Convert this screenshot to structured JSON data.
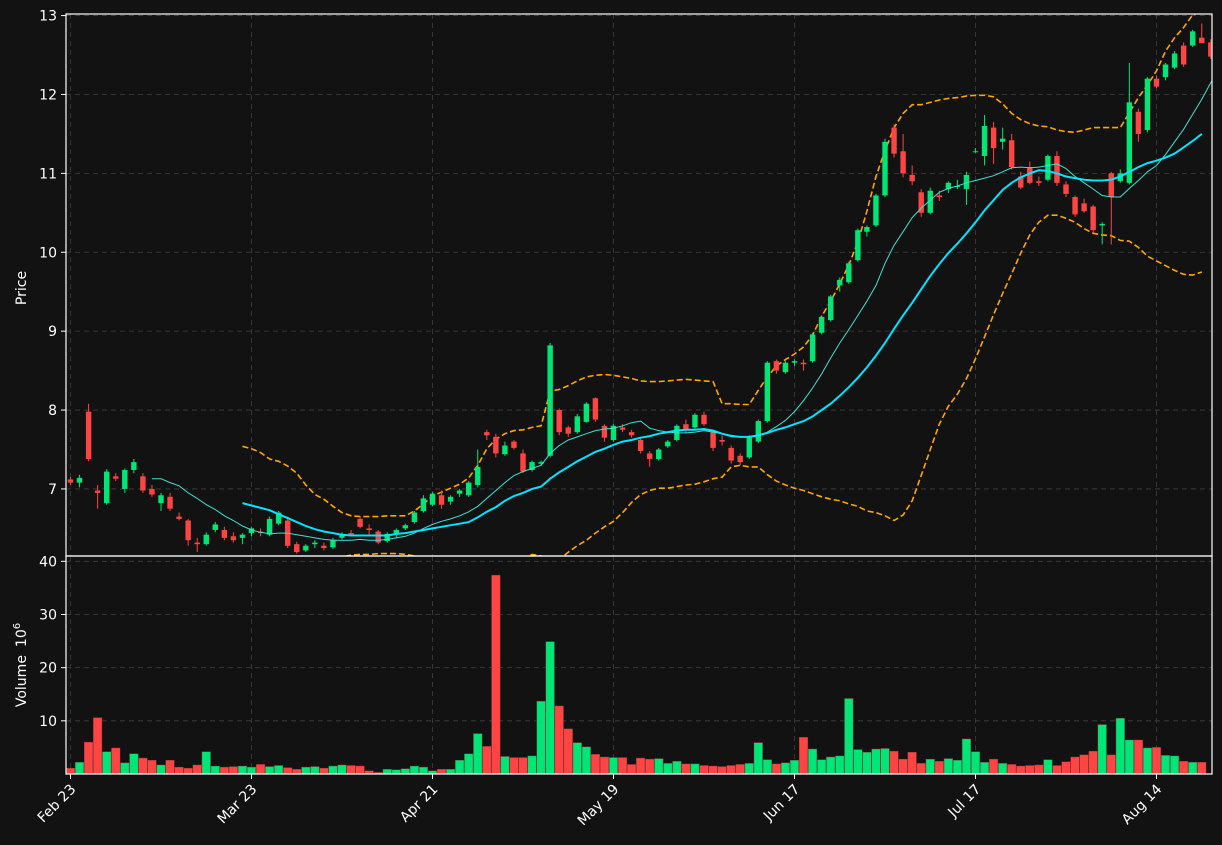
{
  "chart_data": {
    "type": "candlestick",
    "background": "#121212",
    "colors": {
      "up": "#00e676",
      "down": "#ff4444",
      "ma_fast": "#40e0d0",
      "ma_slow": "#00e5ff",
      "bollinger": "#ffa500",
      "grid": "#404040",
      "axis": "#ffffff"
    },
    "price_axis": {
      "label": "Price",
      "ylim": [
        6.15,
        13.02
      ],
      "ticks": [
        7,
        8,
        9,
        10,
        11,
        12,
        13
      ]
    },
    "volume_axis": {
      "label": "Volume",
      "unit_exponent": "6",
      "ylim": [
        0,
        41
      ],
      "ticks": [
        10,
        20,
        30,
        40
      ]
    },
    "x_tick_labels": [
      "Feb 23",
      "Mar 23",
      "Apr 21",
      "May 19",
      "Jun 17",
      "Jul 17",
      "Aug 14"
    ],
    "x_tick_index": [
      0,
      20,
      40,
      60,
      80,
      100,
      120
    ],
    "grid": true,
    "ohlc": [
      [
        7.12,
        7.15,
        7.05,
        7.08
      ],
      [
        7.08,
        7.18,
        7.02,
        7.14
      ],
      [
        7.98,
        8.08,
        7.35,
        7.38
      ],
      [
        6.98,
        7.05,
        6.75,
        6.95
      ],
      [
        6.82,
        7.25,
        6.8,
        7.22
      ],
      [
        7.16,
        7.2,
        7.1,
        7.13
      ],
      [
        7.0,
        7.26,
        6.95,
        7.24
      ],
      [
        7.24,
        7.38,
        7.2,
        7.34
      ],
      [
        7.16,
        7.2,
        6.95,
        6.98
      ],
      [
        7.0,
        7.05,
        6.9,
        6.93
      ],
      [
        6.82,
        6.95,
        6.72,
        6.92
      ],
      [
        6.9,
        6.95,
        6.72,
        6.75
      ],
      [
        6.65,
        6.7,
        6.6,
        6.62
      ],
      [
        6.6,
        6.62,
        6.28,
        6.35
      ],
      [
        6.32,
        6.38,
        6.2,
        6.3
      ],
      [
        6.3,
        6.45,
        6.28,
        6.42
      ],
      [
        6.48,
        6.58,
        6.45,
        6.55
      ],
      [
        6.48,
        6.52,
        6.35,
        6.38
      ],
      [
        6.4,
        6.45,
        6.32,
        6.35
      ],
      [
        6.38,
        6.44,
        6.3,
        6.42
      ],
      [
        6.44,
        6.52,
        6.4,
        6.5
      ],
      [
        6.46,
        6.5,
        6.4,
        6.44
      ],
      [
        6.42,
        6.65,
        6.4,
        6.62
      ],
      [
        6.56,
        6.72,
        6.54,
        6.7
      ],
      [
        6.6,
        6.65,
        6.25,
        6.28
      ],
      [
        6.3,
        6.33,
        6.18,
        6.2
      ],
      [
        6.22,
        6.3,
        6.2,
        6.28
      ],
      [
        6.3,
        6.35,
        6.25,
        6.32
      ],
      [
        6.28,
        6.32,
        6.22,
        6.25
      ],
      [
        6.26,
        6.38,
        6.24,
        6.35
      ],
      [
        6.38,
        6.45,
        6.36,
        6.42
      ],
      [
        6.44,
        6.48,
        6.4,
        6.42
      ],
      [
        6.62,
        6.65,
        6.5,
        6.52
      ],
      [
        6.5,
        6.55,
        6.42,
        6.48
      ],
      [
        6.46,
        6.48,
        6.3,
        6.32
      ],
      [
        6.34,
        6.45,
        6.32,
        6.43
      ],
      [
        6.44,
        6.5,
        6.38,
        6.48
      ],
      [
        6.5,
        6.56,
        6.48,
        6.54
      ],
      [
        6.58,
        6.72,
        6.56,
        6.7
      ],
      [
        6.72,
        6.92,
        6.7,
        6.88
      ],
      [
        6.8,
        6.96,
        6.78,
        6.94
      ],
      [
        6.92,
        6.98,
        6.75,
        6.8
      ],
      [
        6.84,
        6.92,
        6.8,
        6.9
      ],
      [
        6.94,
        7.0,
        6.9,
        6.98
      ],
      [
        6.92,
        7.1,
        6.9,
        7.08
      ],
      [
        7.05,
        7.5,
        7.02,
        7.28
      ],
      [
        7.72,
        7.75,
        7.62,
        7.68
      ],
      [
        7.66,
        7.7,
        7.4,
        7.45
      ],
      [
        7.44,
        7.6,
        7.42,
        7.55
      ],
      [
        7.6,
        7.62,
        7.5,
        7.52
      ],
      [
        7.45,
        7.5,
        7.2,
        7.22
      ],
      [
        7.24,
        7.36,
        7.22,
        7.34
      ],
      [
        7.32,
        7.36,
        7.3,
        7.34
      ],
      [
        7.42,
        8.85,
        7.4,
        8.82
      ],
      [
        8.0,
        8.02,
        7.68,
        7.72
      ],
      [
        7.78,
        7.8,
        7.66,
        7.7
      ],
      [
        7.72,
        7.95,
        7.7,
        7.92
      ],
      [
        7.85,
        8.1,
        7.84,
        8.08
      ],
      [
        8.15,
        8.16,
        7.85,
        7.88
      ],
      [
        7.8,
        7.82,
        7.6,
        7.65
      ],
      [
        7.62,
        7.82,
        7.6,
        7.8
      ],
      [
        7.78,
        7.82,
        7.72,
        7.75
      ],
      [
        7.72,
        7.75,
        7.65,
        7.68
      ],
      [
        7.62,
        7.65,
        7.45,
        7.48
      ],
      [
        7.45,
        7.48,
        7.28,
        7.38
      ],
      [
        7.38,
        7.52,
        7.36,
        7.5
      ],
      [
        7.54,
        7.62,
        7.52,
        7.6
      ],
      [
        7.62,
        7.82,
        7.6,
        7.8
      ],
      [
        7.82,
        7.88,
        7.7,
        7.74
      ],
      [
        7.78,
        7.96,
        7.76,
        7.94
      ],
      [
        7.94,
        7.98,
        7.8,
        7.82
      ],
      [
        7.72,
        7.75,
        7.48,
        7.52
      ],
      [
        7.62,
        7.68,
        7.55,
        7.6
      ],
      [
        7.52,
        7.55,
        7.32,
        7.36
      ],
      [
        7.42,
        7.45,
        7.3,
        7.34
      ],
      [
        7.4,
        7.68,
        7.38,
        7.66
      ],
      [
        7.6,
        7.88,
        7.58,
        7.86
      ],
      [
        7.86,
        8.62,
        7.84,
        8.6
      ],
      [
        8.62,
        8.64,
        8.46,
        8.5
      ],
      [
        8.48,
        8.62,
        8.46,
        8.6
      ],
      [
        8.6,
        8.64,
        8.56,
        8.62
      ],
      [
        8.6,
        8.64,
        8.5,
        8.58
      ],
      [
        8.62,
        8.98,
        8.6,
        8.96
      ],
      [
        8.98,
        9.2,
        8.96,
        9.18
      ],
      [
        9.14,
        9.46,
        9.12,
        9.44
      ],
      [
        9.58,
        9.68,
        9.5,
        9.65
      ],
      [
        9.62,
        9.88,
        9.6,
        9.86
      ],
      [
        9.9,
        10.3,
        9.88,
        10.28
      ],
      [
        10.26,
        10.34,
        10.2,
        10.32
      ],
      [
        10.34,
        10.74,
        10.32,
        10.72
      ],
      [
        10.72,
        11.44,
        10.7,
        11.4
      ],
      [
        11.58,
        11.62,
        11.2,
        11.25
      ],
      [
        11.28,
        11.5,
        10.95,
        11.0
      ],
      [
        10.98,
        11.1,
        10.85,
        10.9
      ],
      [
        10.76,
        10.8,
        10.45,
        10.5
      ],
      [
        10.5,
        10.82,
        10.48,
        10.78
      ],
      [
        10.72,
        10.78,
        10.65,
        10.7
      ],
      [
        10.8,
        10.9,
        10.75,
        10.88
      ],
      [
        10.84,
        10.92,
        10.8,
        10.84
      ],
      [
        10.8,
        11.02,
        10.6,
        10.98
      ],
      [
        11.28,
        11.32,
        11.26,
        11.28
      ],
      [
        11.22,
        11.74,
        11.1,
        11.6
      ],
      [
        11.58,
        11.65,
        11.12,
        11.32
      ],
      [
        11.4,
        11.58,
        11.3,
        11.44
      ],
      [
        11.42,
        11.5,
        11.05,
        11.08
      ],
      [
        10.96,
        11.02,
        10.8,
        10.82
      ],
      [
        11.08,
        11.15,
        10.86,
        10.88
      ],
      [
        10.9,
        10.96,
        10.84,
        10.88
      ],
      [
        10.92,
        11.24,
        10.9,
        11.22
      ],
      [
        11.22,
        11.28,
        10.84,
        10.88
      ],
      [
        10.86,
        10.9,
        10.7,
        10.74
      ],
      [
        10.7,
        10.72,
        10.45,
        10.48
      ],
      [
        10.62,
        10.68,
        10.5,
        10.52
      ],
      [
        10.58,
        10.6,
        10.25,
        10.28
      ],
      [
        10.34,
        10.38,
        10.1,
        10.36
      ],
      [
        11.0,
        11.02,
        10.1,
        10.7
      ],
      [
        10.9,
        11.05,
        10.88,
        11.0
      ],
      [
        10.88,
        12.4,
        10.86,
        11.9
      ],
      [
        11.78,
        11.82,
        11.4,
        11.5
      ],
      [
        11.55,
        12.22,
        11.52,
        12.2
      ],
      [
        12.2,
        12.24,
        12.08,
        12.1
      ],
      [
        12.22,
        12.4,
        12.18,
        12.38
      ],
      [
        12.34,
        12.55,
        12.32,
        12.52
      ],
      [
        12.62,
        12.66,
        12.35,
        12.38
      ],
      [
        12.62,
        12.82,
        12.6,
        12.8
      ],
      [
        12.72,
        12.9,
        12.7,
        12.65
      ],
      [
        12.66,
        12.7,
        12.45,
        12.48
      ]
    ],
    "volume": [
      1.1,
      2.2,
      6.0,
      10.6,
      4.2,
      4.9,
      2.1,
      3.8,
      3.0,
      2.6,
      1.7,
      2.6,
      1.3,
      1.1,
      1.7,
      4.2,
      1.5,
      1.3,
      1.4,
      1.5,
      1.3,
      1.8,
      1.4,
      1.6,
      1.2,
      0.9,
      1.3,
      1.4,
      1.1,
      1.5,
      1.7,
      1.6,
      1.5,
      0.6,
      0.3,
      0.9,
      0.8,
      1.0,
      1.5,
      1.3,
      0.6,
      0.9,
      0.9,
      2.6,
      3.8,
      7.6,
      5.2,
      37.4,
      3.3,
      3.1,
      3.1,
      3.4,
      13.7,
      24.9,
      12.8,
      8.5,
      5.9,
      5.1,
      3.7,
      3.2,
      3.1,
      3.1,
      1.8,
      3.0,
      2.8,
      2.9,
      2.0,
      2.4,
      1.9,
      1.9,
      1.6,
      1.5,
      1.4,
      1.6,
      1.8,
      2.0,
      5.9,
      2.7,
      1.9,
      2.1,
      2.6,
      6.9,
      4.7,
      2.7,
      3.2,
      3.4,
      14.2,
      4.6,
      4.1,
      4.7,
      4.8,
      4.3,
      2.8,
      4.1,
      2.0,
      2.8,
      2.4,
      2.9,
      2.6,
      6.6,
      4.2,
      2.2,
      2.8,
      2.0,
      1.8,
      1.5,
      1.6,
      1.7,
      2.7,
      1.6,
      2.3,
      3.2,
      3.6,
      4.3,
      9.3,
      3.6,
      10.5,
      6.4,
      6.4,
      4.9,
      5.0,
      3.5,
      3.4,
      2.4,
      2.2,
      2.2
    ],
    "ma_fast": [
      null,
      null,
      null,
      null,
      null,
      null,
      null,
      null,
      null,
      7.13,
      7.13,
      7.08,
      7.04,
      6.95,
      6.88,
      6.8,
      6.74,
      6.66,
      6.6,
      6.53,
      6.48,
      6.45,
      6.43,
      6.44,
      6.44,
      6.42,
      6.4,
      6.38,
      6.36,
      6.35,
      6.35,
      6.35,
      6.36,
      6.35,
      6.35,
      6.36,
      6.38,
      6.4,
      6.44,
      6.5,
      6.55,
      6.59,
      6.62,
      6.66,
      6.71,
      6.78,
      6.88,
      6.98,
      7.08,
      7.17,
      7.22,
      7.26,
      7.3,
      7.45,
      7.55,
      7.62,
      7.66,
      7.7,
      7.74,
      7.76,
      7.77,
      7.8,
      7.84,
      7.86,
      7.77,
      7.74,
      7.72,
      7.71,
      7.71,
      7.72,
      7.74,
      7.72,
      7.7,
      7.68,
      7.66,
      7.66,
      7.67,
      7.72,
      7.79,
      7.87,
      7.98,
      8.12,
      8.28,
      8.46,
      8.66,
      8.85,
      9.02,
      9.2,
      9.38,
      9.58,
      9.86,
      10.09,
      10.26,
      10.44,
      10.56,
      10.66,
      10.76,
      10.81,
      10.84,
      10.88,
      10.91,
      10.94,
      10.97,
      11.02,
      11.07,
      11.08,
      11.07,
      11.08,
      11.1,
      11.12,
      11.06,
      10.96,
      10.88,
      10.8,
      10.72,
      10.7,
      10.7,
      10.81,
      10.91,
      11.02,
      11.1,
      11.24,
      11.4,
      11.56,
      11.75,
      11.94,
      12.15,
      12.32
    ],
    "ma_slow": [
      null,
      null,
      null,
      null,
      null,
      null,
      null,
      null,
      null,
      null,
      null,
      null,
      null,
      null,
      null,
      null,
      null,
      null,
      null,
      6.82,
      6.79,
      6.76,
      6.73,
      6.68,
      6.63,
      6.58,
      6.53,
      6.49,
      6.46,
      6.44,
      6.42,
      6.41,
      6.41,
      6.41,
      6.41,
      6.41,
      6.43,
      6.44,
      6.46,
      6.48,
      6.5,
      6.52,
      6.54,
      6.56,
      6.58,
      6.64,
      6.71,
      6.77,
      6.85,
      6.91,
      6.95,
      7.0,
      7.03,
      7.13,
      7.21,
      7.28,
      7.35,
      7.41,
      7.47,
      7.51,
      7.56,
      7.6,
      7.62,
      7.65,
      7.67,
      7.7,
      7.72,
      7.74,
      7.75,
      7.75,
      7.76,
      7.74,
      7.7,
      7.67,
      7.66,
      7.66,
      7.68,
      7.71,
      7.75,
      7.78,
      7.82,
      7.86,
      7.92,
      8.0,
      8.08,
      8.18,
      8.29,
      8.41,
      8.54,
      8.69,
      8.85,
      9.03,
      9.2,
      9.36,
      9.53,
      9.7,
      9.85,
      9.99,
      10.11,
      10.24,
      10.38,
      10.53,
      10.66,
      10.79,
      10.88,
      10.95,
      11.0,
      11.04,
      11.03,
      11.0,
      10.96,
      10.94,
      10.92,
      10.91,
      10.91,
      10.92,
      10.96,
      11.02,
      11.08,
      11.13,
      11.16,
      11.2,
      11.25,
      11.33,
      11.41,
      11.5
    ],
    "boll_upper": [
      null,
      null,
      null,
      null,
      null,
      null,
      null,
      null,
      null,
      null,
      null,
      null,
      null,
      null,
      null,
      null,
      null,
      null,
      null,
      7.54,
      7.51,
      7.46,
      7.38,
      7.35,
      7.29,
      7.2,
      7.05,
      6.93,
      6.87,
      6.78,
      6.7,
      6.66,
      6.65,
      6.65,
      6.65,
      6.66,
      6.66,
      6.66,
      6.72,
      6.81,
      6.91,
      6.96,
      7.01,
      7.06,
      7.14,
      7.3,
      7.51,
      7.63,
      7.7,
      7.74,
      7.75,
      7.78,
      7.8,
      8.24,
      8.26,
      8.31,
      8.37,
      8.42,
      8.44,
      8.45,
      8.44,
      8.42,
      8.4,
      8.37,
      8.36,
      8.36,
      8.37,
      8.38,
      8.39,
      8.38,
      8.37,
      8.36,
      8.08,
      8.08,
      8.07,
      8.07,
      8.25,
      8.42,
      8.56,
      8.64,
      8.71,
      8.8,
      8.95,
      9.19,
      9.38,
      9.6,
      9.84,
      10.13,
      10.52,
      10.96,
      11.29,
      11.58,
      11.76,
      11.87,
      11.87,
      11.9,
      11.93,
      11.95,
      11.96,
      11.98,
      11.99,
      11.99,
      11.97,
      11.88,
      11.76,
      11.68,
      11.63,
      11.6,
      11.59,
      11.55,
      11.53,
      11.52,
      11.55,
      11.58,
      11.58,
      11.58,
      11.58,
      11.77,
      11.96,
      12.12,
      12.3,
      12.55,
      12.72,
      12.85,
      13.01,
      13.05,
      13.05,
      13.05
    ],
    "boll_lower": [
      null,
      null,
      null,
      null,
      null,
      null,
      null,
      null,
      null,
      null,
      null,
      null,
      null,
      null,
      null,
      null,
      null,
      null,
      null,
      6.1,
      6.07,
      6.06,
      6.08,
      6.01,
      5.97,
      5.96,
      6.01,
      6.05,
      6.05,
      6.1,
      6.14,
      6.16,
      6.17,
      6.17,
      6.18,
      6.18,
      6.18,
      6.17,
      6.15,
      6.13,
      6.12,
      6.1,
      6.09,
      6.07,
      6.05,
      6.03,
      6.02,
      6.0,
      6.03,
      6.07,
      6.12,
      6.17,
      6.15,
      6.0,
      6.1,
      6.2,
      6.28,
      6.35,
      6.44,
      6.52,
      6.59,
      6.7,
      6.83,
      6.93,
      6.98,
      7.01,
      7.01,
      7.03,
      7.05,
      7.06,
      7.09,
      7.13,
      7.15,
      7.28,
      7.3,
      7.28,
      7.28,
      7.18,
      7.1,
      7.05,
      7.01,
      6.98,
      6.94,
      6.9,
      6.87,
      6.85,
      6.81,
      6.78,
      6.72,
      6.7,
      6.66,
      6.6,
      6.67,
      6.85,
      7.17,
      7.5,
      7.82,
      8.05,
      8.2,
      8.4,
      8.65,
      8.93,
      9.21,
      9.48,
      9.73,
      9.99,
      10.22,
      10.38,
      10.47,
      10.47,
      10.43,
      10.38,
      10.3,
      10.24,
      10.22,
      10.21,
      10.15,
      10.14,
      10.06,
      9.95,
      9.89,
      9.83,
      9.77,
      9.72,
      9.71,
      9.75
    ]
  }
}
